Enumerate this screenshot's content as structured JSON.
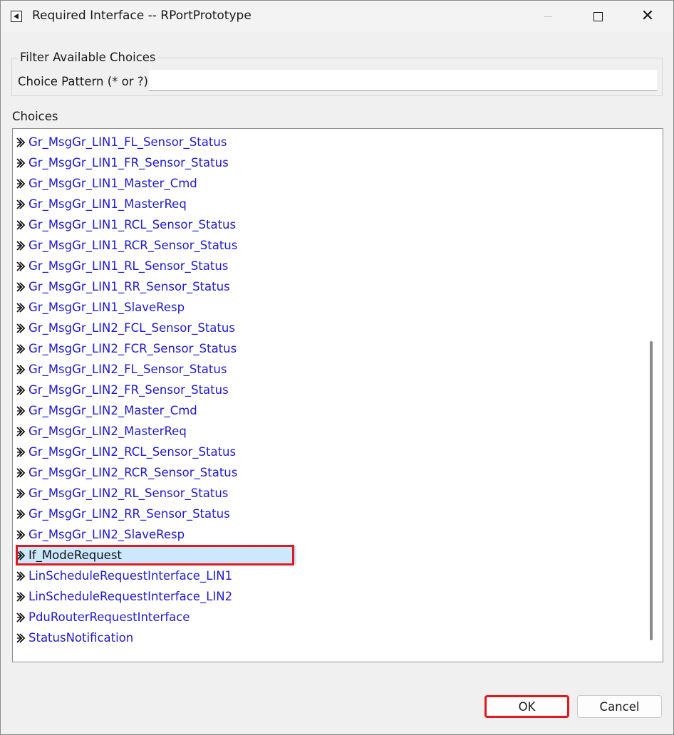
{
  "window": {
    "title": "Required Interface -- RPortPrototype",
    "controls": {
      "minimize": "minimize",
      "maximize": "maximize",
      "close": "✕"
    }
  },
  "filter": {
    "group_label": "Filter Available Choices",
    "pattern_label": "Choice Pattern (* or ?)",
    "pattern_value": "",
    "pattern_placeholder": ""
  },
  "choices": {
    "label": "Choices",
    "selected_index": 20,
    "items": [
      "Gr_MsgGr_LIN1_FL_Sensor_Status",
      "Gr_MsgGr_LIN1_FR_Sensor_Status",
      "Gr_MsgGr_LIN1_Master_Cmd",
      "Gr_MsgGr_LIN1_MasterReq",
      "Gr_MsgGr_LIN1_RCL_Sensor_Status",
      "Gr_MsgGr_LIN1_RCR_Sensor_Status",
      "Gr_MsgGr_LIN1_RL_Sensor_Status",
      "Gr_MsgGr_LIN1_RR_Sensor_Status",
      "Gr_MsgGr_LIN1_SlaveResp",
      "Gr_MsgGr_LIN2_FCL_Sensor_Status",
      "Gr_MsgGr_LIN2_FCR_Sensor_Status",
      "Gr_MsgGr_LIN2_FL_Sensor_Status",
      "Gr_MsgGr_LIN2_FR_Sensor_Status",
      "Gr_MsgGr_LIN2_Master_Cmd",
      "Gr_MsgGr_LIN2_MasterReq",
      "Gr_MsgGr_LIN2_RCL_Sensor_Status",
      "Gr_MsgGr_LIN2_RCR_Sensor_Status",
      "Gr_MsgGr_LIN2_RL_Sensor_Status",
      "Gr_MsgGr_LIN2_RR_Sensor_Status",
      "Gr_MsgGr_LIN2_SlaveResp",
      "If_ModeRequest",
      "LinScheduleRequestInterface_LIN1",
      "LinScheduleRequestInterface_LIN2",
      "PduRouterRequestInterface",
      "StatusNotification"
    ],
    "item_icon": "interface-arrow-icon",
    "scroll_position_fraction": 1.0
  },
  "buttons": {
    "ok": "OK",
    "cancel": "Cancel"
  },
  "colors": {
    "link": "#1f1ad0",
    "selection": "#cce8ff",
    "highlight": "#e0191f"
  }
}
